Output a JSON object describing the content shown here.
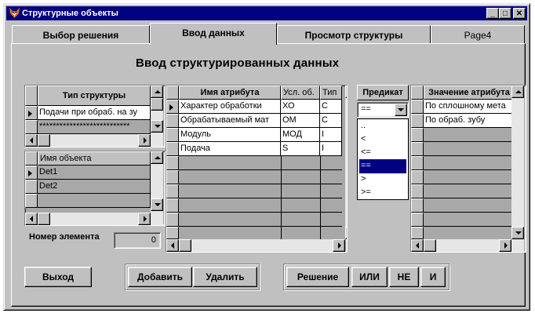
{
  "window": {
    "title": "Структурные объекты",
    "buttons": {
      "minimize": "_",
      "maximize": "□",
      "close": "✕"
    }
  },
  "tabs": [
    {
      "label": "Выбор решения"
    },
    {
      "label": "Ввод данных"
    },
    {
      "label": "Просмотр структуры"
    },
    {
      "label": "Page4"
    }
  ],
  "heading": "Ввод структурированных данных",
  "structure_grid": {
    "header": "Тип структуры",
    "rows": [
      "Подачи при обраб. на зу",
      "***************************"
    ]
  },
  "object_grid": {
    "header": "Имя объекта",
    "rows": [
      "Det1",
      "Det2"
    ]
  },
  "element_number": {
    "label": "Номер элемента",
    "value": "0"
  },
  "attribute_grid": {
    "headers": [
      "Имя атрибута",
      "Усл. об.",
      "Тип"
    ],
    "rows": [
      [
        "Характер обработки",
        "ХО",
        "С"
      ],
      [
        "Обрабатываемый мат",
        "ОМ",
        "С"
      ],
      [
        "Модуль",
        "МОД",
        "I"
      ],
      [
        "Подача",
        "S",
        "I"
      ]
    ]
  },
  "predicate": {
    "header": "Предикат",
    "selected": "==",
    "options": [
      "..",
      "<",
      "<=",
      "==",
      ">",
      ">="
    ],
    "selected_index": 3
  },
  "value_grid": {
    "header": "Значение атрибута",
    "rows": [
      "По сплошному мета",
      "По обраб. зубу"
    ]
  },
  "buttons": {
    "exit": "Выход",
    "add": "Добавить",
    "delete": "Удалить",
    "decision": "Решение",
    "or": "ИЛИ",
    "not": "НЕ",
    "and": "И"
  }
}
